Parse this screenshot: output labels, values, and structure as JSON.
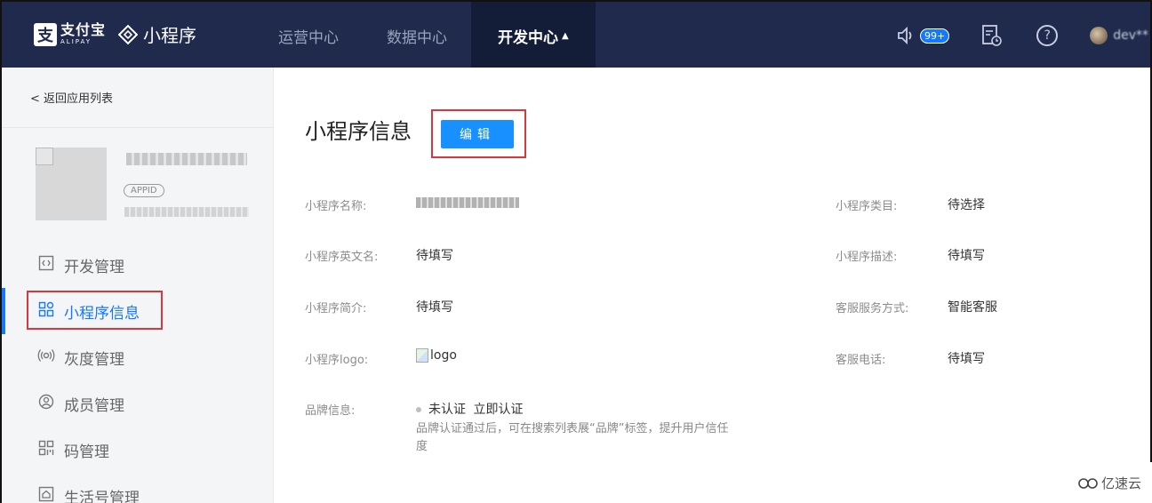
{
  "header": {
    "alipay_cn": "支付宝",
    "alipay_en": "ALIPAY",
    "alipay_mark": "支",
    "product_title": "小程序",
    "nav": [
      {
        "label": "运营中心",
        "active": false
      },
      {
        "label": "数据中心",
        "active": false
      },
      {
        "label": "开发中心",
        "active": true,
        "caret": "▲"
      }
    ],
    "notification_badge": "99+",
    "help_symbol": "?",
    "username": "dev**"
  },
  "sidebar": {
    "back_label": "< 返回应用列表",
    "appid_tag": "APPID",
    "items": [
      {
        "label": "开发管理",
        "icon": "code-icon",
        "glyph": "‹›"
      },
      {
        "label": "小程序信息",
        "icon": "grid-icon",
        "glyph": "⊞",
        "active": true
      },
      {
        "label": "灰度管理",
        "icon": "broadcast-icon",
        "glyph": "((•))"
      },
      {
        "label": "成员管理",
        "icon": "user-icon",
        "glyph": "☺"
      },
      {
        "label": "码管理",
        "icon": "qrcode-icon",
        "glyph": "▦"
      },
      {
        "label": "生活号管理",
        "icon": "home-icon",
        "glyph": "⌂"
      }
    ]
  },
  "main": {
    "title": "小程序信息",
    "edit_label": "编辑",
    "fields_left": [
      {
        "label": "小程序名称:",
        "value": ""
      },
      {
        "label": "小程序英文名:",
        "value": "待填写"
      },
      {
        "label": "小程序简介:",
        "value": "待填写"
      },
      {
        "label": "小程序logo:",
        "value": "logo"
      },
      {
        "label": "品牌信息:",
        "value": "未认证"
      }
    ],
    "fields_right": [
      {
        "label": "小程序类目:",
        "value": "待选择"
      },
      {
        "label": "小程序描述:",
        "value": "待填写"
      },
      {
        "label": "客服服务方式:",
        "value": "智能客服"
      },
      {
        "label": "客服电话:",
        "value": "待填写"
      }
    ],
    "brand_action": "立即认证",
    "brand_desc": "品牌认证通过后，可在搜索列表展“品牌”标签，提升用户信任度"
  },
  "watermark": "亿速云"
}
